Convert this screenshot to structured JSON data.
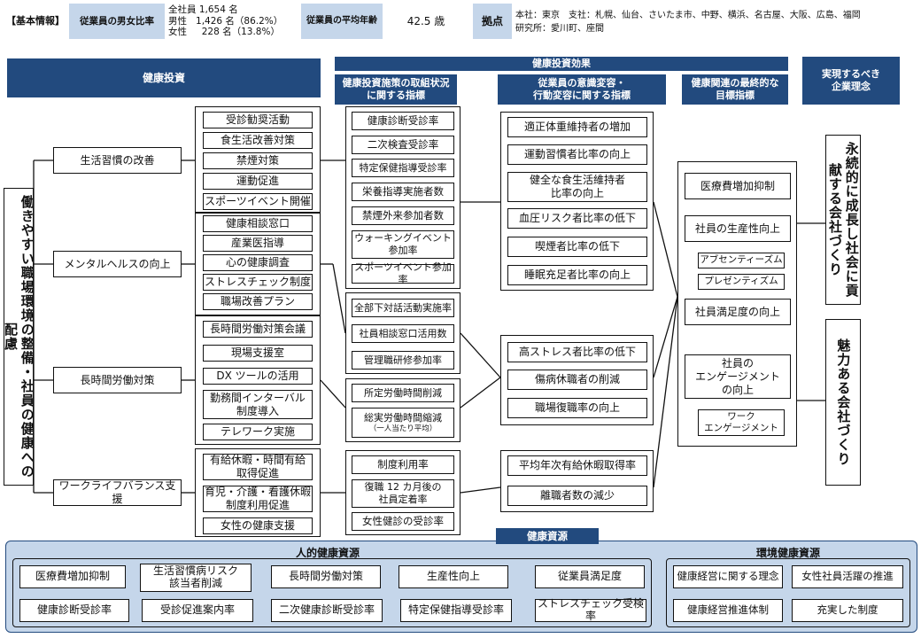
{
  "basic_info": {
    "tag": "【基本情報】",
    "gender_label": "従業員の男女比率",
    "total_label": "全社員",
    "total_value": "1,654 名",
    "male_label": "男性",
    "male_value": "1,426 名（86.2%）",
    "female_label": "女性",
    "female_value": "228 名（13.8%）",
    "age_label": "従業員の平均年齢",
    "age_value": "42.5 歳",
    "base_label": "拠点",
    "base_value_1": "本社：東京　支社：札幌、仙台、さいたま市、中野、横浜、名古屋、大阪、広島、福岡",
    "base_value_2": "研究所：愛川町、座間"
  },
  "headers": {
    "investment": "健康投資",
    "effect": "健康投資効果",
    "col_indicators": "健康投資施策の取組状況\nに関する指標",
    "col_awareness": "従業員の意識変容・\n行動変容に関する指標",
    "col_final": "健康関連の最終的な\n目標指標",
    "col_philosophy": "実現するべき\n企業理念"
  },
  "left_vertical": "働きやすい職場環境の整備・社員の健康への配慮",
  "categories": [
    {
      "label": "生活習慣の改善"
    },
    {
      "label": "メンタルヘルスの向上"
    },
    {
      "label": "長時間労働対策"
    },
    {
      "label": "ワークライフバランス支援"
    }
  ],
  "measures": [
    [
      "受診勧奨活動",
      "食生活改善対策",
      "禁煙対策",
      "運動促進",
      "スポーツイベント開催"
    ],
    [
      "健康相談窓口",
      "産業医指導",
      "心の健康調査",
      "ストレスチェック制度",
      "職場改善プラン"
    ],
    [
      "長時間労働対策会議",
      "現場支援室",
      "DX ツールの活用",
      "勤務間インターバル\n制度導入",
      "テレワーク実施"
    ],
    [
      "有給休暇・時間有給\n取得促進",
      "育児・介護・看護休暇\n制度利用促進",
      "女性の健康支援"
    ]
  ],
  "indicators": [
    [
      "健康診断受診率",
      "二次検査受診率",
      "特定保健指導受診率",
      "栄養指導実施者数",
      "禁煙外来参加者数",
      "ウォーキングイベント\n参加率",
      "スポーツイベント参加率"
    ],
    [
      "全部下対話活動実施率",
      "社員相談窓口活用数",
      "管理職研修参加率"
    ],
    [
      "所定労働時間削減",
      "総実労働時間縮減"
    ],
    [
      "制度利用率",
      "復職 12 カ月後の\n社員定着率",
      "女性健診の受診率"
    ]
  ],
  "indicator_note": "（一人当たり平均）",
  "awareness": [
    [
      "適正体重維持者の増加",
      "運動習慣者比率の向上",
      "健全な食生活維持者\n比率の向上",
      "血圧リスク者比率の低下",
      "喫煙者比率の低下",
      "睡眠充足者比率の向上"
    ],
    [
      "高ストレス者比率の低下",
      "傷病休職者の削減",
      "職場復職率の向上"
    ],
    [
      "平均年次有給休暇取得率",
      "離職者数の減少"
    ]
  ],
  "final_goals": [
    "医療費増加抑制",
    "社員の生産性向上",
    "アブセンティーズム",
    "プレゼンティズム",
    "社員満足度の向上",
    "社員の\nエンゲージメント\nの向上",
    "ワーク\nエンゲージメント"
  ],
  "philosophy": [
    "永続的に成長し社会に貢献する会社づくり",
    "魅力ある会社づくり"
  ],
  "resources": {
    "title": "健康資源",
    "human_title": "人的健康資源",
    "human_items": [
      "医療費増加抑制",
      "生活習慣病リスク\n該当者削減",
      "長時間労働対策",
      "生産性向上",
      "従業員満足度",
      "健康診断受診率",
      "受診促進案内率",
      "二次健康診断受診率",
      "特定保健指導受診率",
      "ストレスチェック受検率"
    ],
    "env_title": "環境健康資源",
    "env_items": [
      "健康経営に関する理念",
      "女性社員活躍の推進",
      "健康経営推進体制",
      "充実した制度"
    ]
  },
  "colors": {
    "header_blue": "#224a7e",
    "label_blue": "#c5d6ea",
    "resource_bg": "#c5d6ea",
    "line": "#111111"
  }
}
